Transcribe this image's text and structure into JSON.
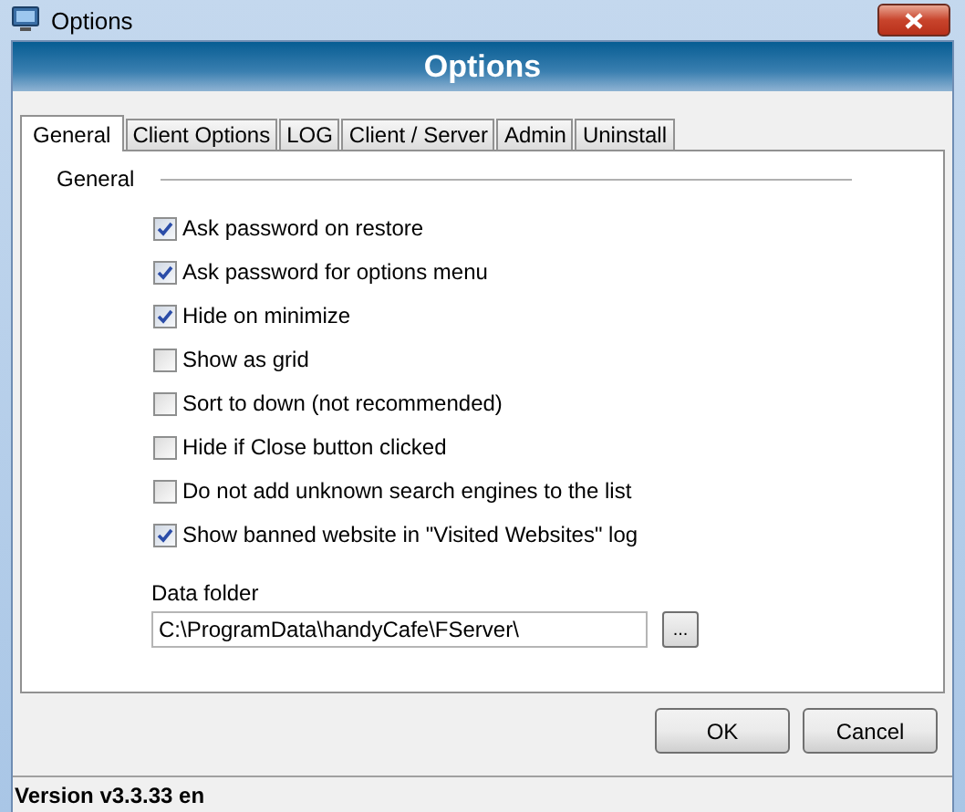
{
  "window": {
    "title": "Options"
  },
  "header": {
    "title": "Options"
  },
  "tabs": [
    {
      "label": "General",
      "selected": true
    },
    {
      "label": "Client Options",
      "selected": false
    },
    {
      "label": "LOG",
      "selected": false
    },
    {
      "label": "Client / Server",
      "selected": false
    },
    {
      "label": "Admin",
      "selected": false
    },
    {
      "label": "Uninstall",
      "selected": false
    }
  ],
  "group": {
    "title": "General"
  },
  "options": [
    {
      "label": "Ask password on restore",
      "checked": true
    },
    {
      "label": "Ask password for options menu",
      "checked": true
    },
    {
      "label": "Hide on minimize",
      "checked": true
    },
    {
      "label": "Show as grid",
      "checked": false
    },
    {
      "label": "Sort to down (not recommended)",
      "checked": false
    },
    {
      "label": "Hide if Close button clicked",
      "checked": false
    },
    {
      "label": "Do not add unknown search engines to the list",
      "checked": false
    },
    {
      "label": "Show banned website in \"Visited Websites\" log",
      "checked": true
    }
  ],
  "data_folder": {
    "label": "Data folder",
    "value": "C:\\ProgramData\\handyCafe\\FServer\\",
    "browse": "..."
  },
  "buttons": [
    "OK",
    "Cancel"
  ],
  "status_bar": "Version v3.3.33 en"
}
